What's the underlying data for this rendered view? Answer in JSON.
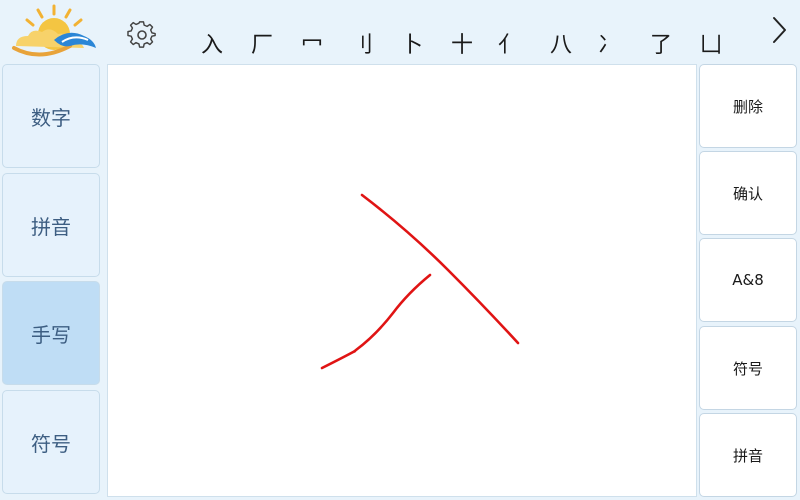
{
  "candidates": [
    "入",
    "厂",
    "冖",
    "刂",
    "卜",
    "十",
    "亻",
    "八",
    "冫",
    "了",
    "凵"
  ],
  "mode_buttons": [
    "数字",
    "拼音",
    "手写",
    "符号"
  ],
  "active_mode": "手写",
  "action_buttons": [
    "删除",
    "确认",
    "A&8",
    "符号",
    "拼音"
  ],
  "colors": {
    "background": "#e8f3fb",
    "mode_button": "#e6f2fc",
    "mode_button_active": "#bfddf5",
    "mode_text": "#3d5e82",
    "ink": "#e01414"
  },
  "icons": {
    "logo": "sun-cloud-logo",
    "settings": "gear-icon",
    "next": "chevron-right-icon"
  }
}
